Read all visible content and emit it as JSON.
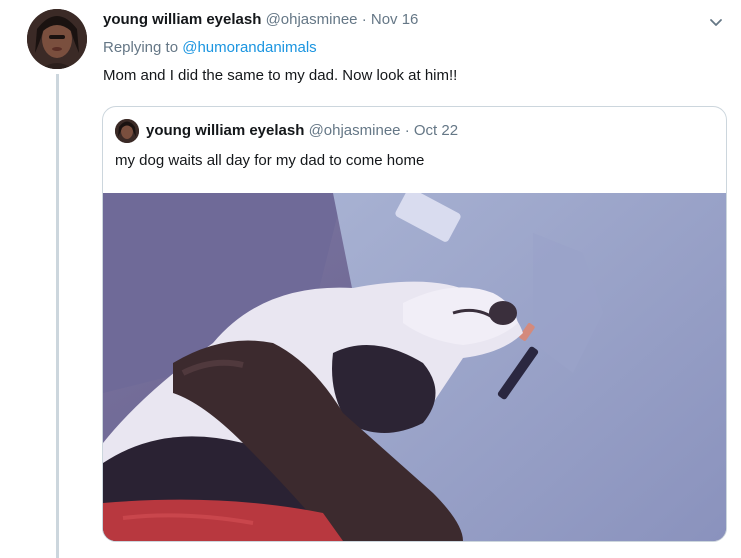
{
  "tweet": {
    "author_name": "young william eyelash",
    "author_handle": "@ohjasminee",
    "separator": "·",
    "date": "Nov 16",
    "replying_prefix": "Replying to",
    "replying_mention": "@humorandanimals",
    "text": "Mom and I did the same to my dad. Now look at him!!",
    "menu_icon": "chevron-down-icon"
  },
  "quoted": {
    "author_name": "young william eyelash",
    "author_handle": "@ohjasminee",
    "separator": "·",
    "date": "Oct 22",
    "text": "my dog waits all day for my dad to come home",
    "media": "photo of a black-and-white dog lying across a man's chest"
  },
  "colors": {
    "text_primary": "#14171a",
    "text_secondary": "#657786",
    "link": "#1b95e0",
    "border": "#ccd6dd"
  }
}
